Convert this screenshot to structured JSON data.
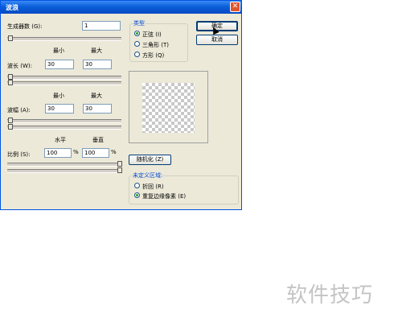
{
  "dialog": {
    "title": "波浪",
    "close_glyph": "✕"
  },
  "generators": {
    "label": "生成器数 (G):",
    "value": "1"
  },
  "col_labels": {
    "min": "最小",
    "max": "最大"
  },
  "wavelength": {
    "label": "波长 (W):",
    "min": "30",
    "max": "30"
  },
  "amplitude": {
    "label": "波幅 (A):",
    "min": "30",
    "max": "30"
  },
  "scale_labels": {
    "horizontal": "水平",
    "vertical": "垂直"
  },
  "scale": {
    "label": "比例 (S):",
    "horizontal": "100",
    "vertical": "100",
    "unit": "%"
  },
  "type_group": {
    "label": "类型",
    "options": [
      "正弦 (I)",
      "三角形 (T)",
      "方形 (Q)"
    ],
    "selected": 0
  },
  "buttons": {
    "ok": "确定",
    "cancel": "取消",
    "randomize": "随机化 (Z)"
  },
  "undefined_group": {
    "label": "未定义区域:",
    "options": [
      "折回 (R)",
      "重复边缘像素 (E)"
    ],
    "selected": 1
  },
  "watermark": "软件技巧"
}
